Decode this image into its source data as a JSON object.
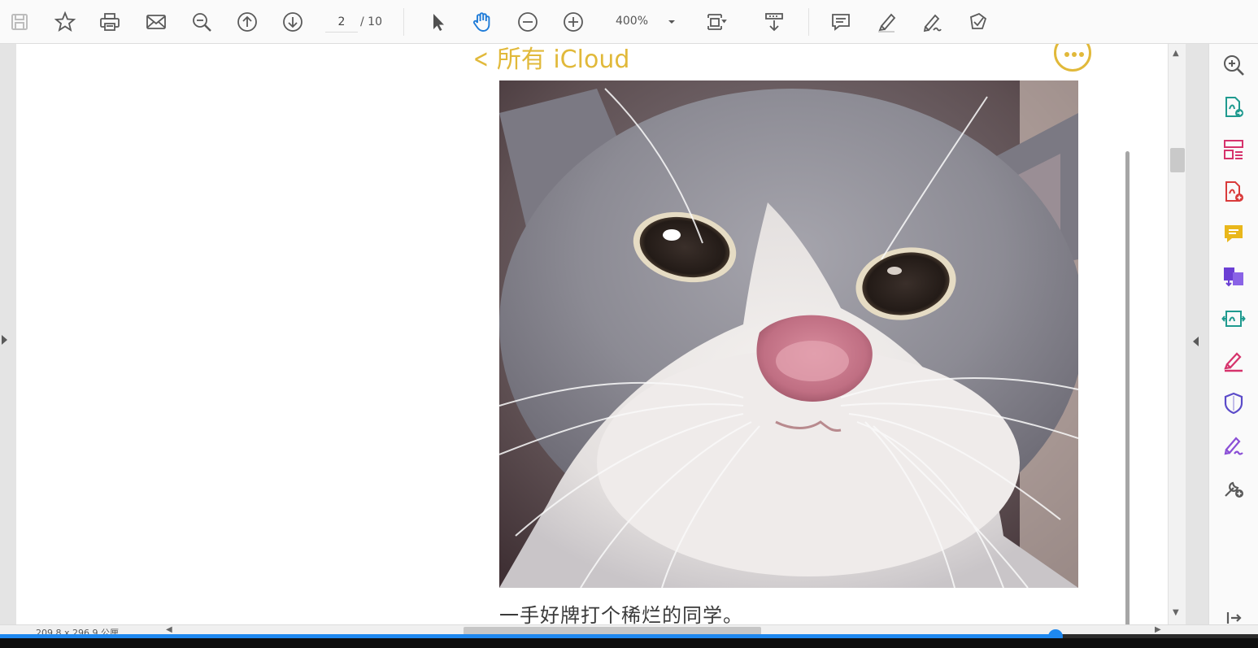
{
  "toolbar": {
    "page_current": "2",
    "page_total": "/ 10",
    "zoom": "400%",
    "icons": [
      "save-icon",
      "bookmark-star-icon",
      "print-icon",
      "email-icon",
      "find-icon",
      "previous-page-icon",
      "next-page-icon",
      "select-cursor-icon",
      "hand-tool-icon",
      "zoom-out-icon",
      "zoom-in-icon",
      "fit-page-icon",
      "scrolling-mode-icon",
      "comment-icon",
      "highlight-icon",
      "draw-icon",
      "fill-sign-icon"
    ]
  },
  "document": {
    "note_back_label": "所有 iCloud",
    "caption": "一手好牌打个稀烂的同学。"
  },
  "tools_pane": {
    "icons": [
      "tool-zoom-icon",
      "export-pdf-icon",
      "organize-pages-icon",
      "create-pdf-icon",
      "comment-tool-icon",
      "combine-files-icon",
      "edit-pdf-icon",
      "fill-and-sign-icon",
      "protect-icon",
      "request-signature-icon",
      "more-tools-icon",
      "collapse-pane-icon"
    ]
  },
  "status": {
    "page_size": "209.8 x 296.9 公厘"
  },
  "video": {
    "progress": 0.839
  },
  "colors": {
    "accent_blue": "#1e88f0",
    "notes_gold": "#e1b93a"
  }
}
